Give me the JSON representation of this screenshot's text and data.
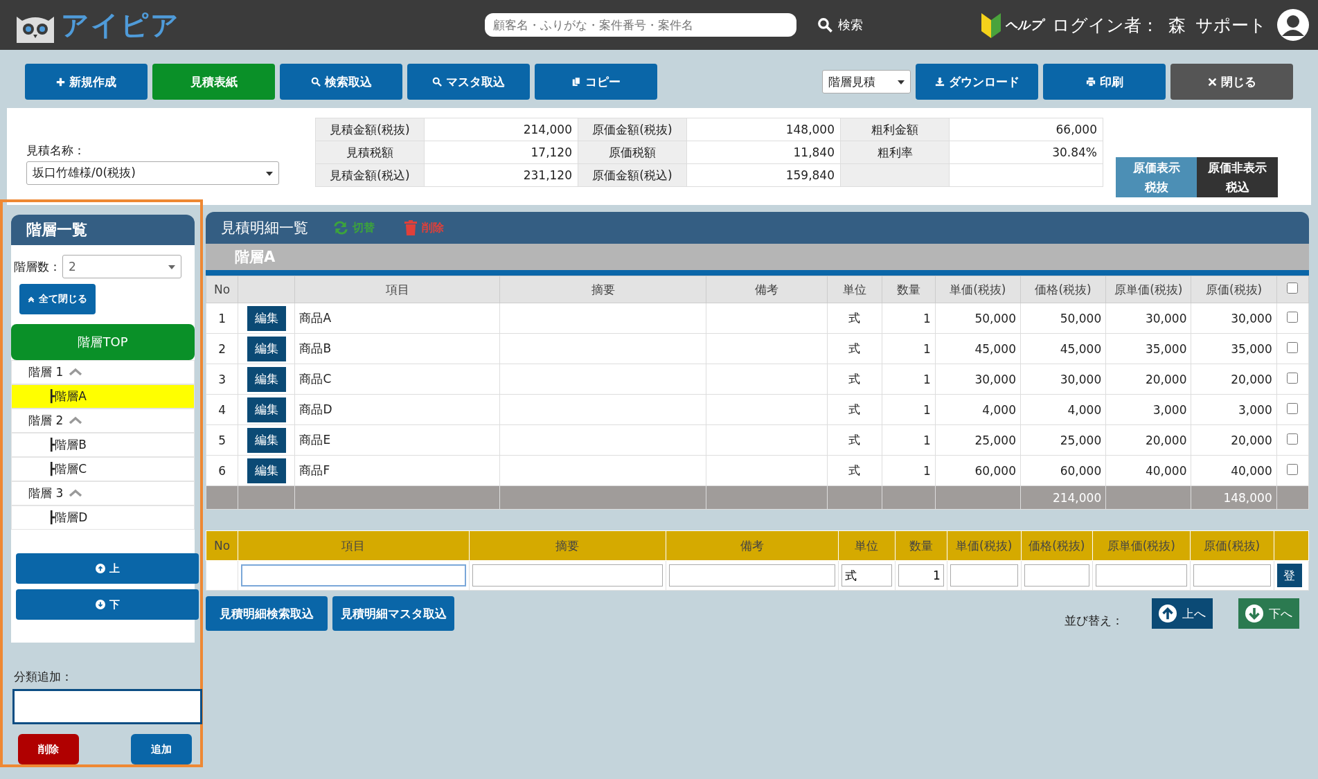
{
  "header": {
    "logo": "アイピア",
    "search": {
      "placeholder": "顧客名・ふりがな・案件番号・案件名"
    },
    "search_button": "検索",
    "help": "ヘルプ",
    "login_label": "ログイン者：",
    "user": "森",
    "support": "サポート"
  },
  "toolbar": {
    "left_buttons": [
      {
        "label": "新規作成",
        "kind": "primary"
      },
      {
        "label": "見積表紙",
        "kind": "success"
      },
      {
        "label": "検索取込",
        "kind": "primary"
      },
      {
        "label": "マスタ取込",
        "kind": "primary"
      },
      {
        "label": "コピー",
        "kind": "primary"
      }
    ],
    "mode_select": "階層見積",
    "right_buttons": [
      {
        "label": "ダウンロード",
        "kind": "primary"
      },
      {
        "label": "印刷",
        "kind": "primary"
      },
      {
        "label": "閉じる",
        "kind": "dark"
      }
    ]
  },
  "summary": {
    "name_label": "見積名称：",
    "name_value": "坂口竹雄様/0(税抜)",
    "rows": [
      [
        "見積金額(税抜)",
        "214,000",
        "原価金額(税抜)",
        "148,000",
        "粗利金額",
        "66,000"
      ],
      [
        "見積税額",
        "17,120",
        "原価税額",
        "11,840",
        "粗利率",
        "30.84%"
      ],
      [
        "見積金額(税込)",
        "231,120",
        "原価金額(税込)",
        "159,840",
        "",
        ""
      ]
    ],
    "toggles": [
      {
        "line1": "原価表示",
        "line2": "税抜",
        "selected": false
      },
      {
        "line1": "原価非表示",
        "line2": "税込",
        "selected": true
      }
    ]
  },
  "sidebar": {
    "title": "階層一覧",
    "count_label": "階層数：",
    "count_value": "2",
    "collapse_button": "全て閉じる",
    "top_button": "階層TOP",
    "tree": [
      {
        "label": "階層 1",
        "expanded": true,
        "children": [
          {
            "label": "┣階層A",
            "selected": true
          }
        ]
      },
      {
        "label": "階層 2",
        "expanded": true,
        "children": [
          {
            "label": "┣階層B",
            "selected": false
          },
          {
            "label": "┣階層C",
            "selected": false
          }
        ]
      },
      {
        "label": "階層 3",
        "expanded": true,
        "children": [
          {
            "label": "┣階層D",
            "selected": false
          }
        ]
      }
    ],
    "up_button": "上",
    "down_button": "下",
    "add_label": "分類追加：",
    "delete_button": "削除",
    "add_button": "追加"
  },
  "detail": {
    "title": "見積明細一覧",
    "switch_action": "切替",
    "delete_action": "削除",
    "group": "階層A",
    "columns": [
      "No",
      "",
      "項目",
      "摘要",
      "備考",
      "単位",
      "数量",
      "単価(税抜)",
      "価格(税抜)",
      "原単価(税抜)",
      "原価(税抜)"
    ],
    "rows": [
      {
        "no": "1",
        "edit": "編集",
        "item": "商品A",
        "unit": "式",
        "qty": "1",
        "unit_price": "50,000",
        "price": "50,000",
        "cost_unit": "30,000",
        "cost": "30,000",
        "checked": false
      },
      {
        "no": "2",
        "edit": "編集",
        "item": "商品B",
        "unit": "式",
        "qty": "1",
        "unit_price": "45,000",
        "price": "45,000",
        "cost_unit": "35,000",
        "cost": "35,000",
        "checked": false
      },
      {
        "no": "3",
        "edit": "編集",
        "item": "商品C",
        "unit": "式",
        "qty": "1",
        "unit_price": "30,000",
        "price": "30,000",
        "cost_unit": "20,000",
        "cost": "20,000",
        "checked": false
      },
      {
        "no": "4",
        "edit": "編集",
        "item": "商品D",
        "unit": "式",
        "qty": "1",
        "unit_price": "4,000",
        "price": "4,000",
        "cost_unit": "3,000",
        "cost": "3,000",
        "checked": false
      },
      {
        "no": "5",
        "edit": "編集",
        "item": "商品E",
        "unit": "式",
        "qty": "1",
        "unit_price": "25,000",
        "price": "25,000",
        "cost_unit": "20,000",
        "cost": "20,000",
        "checked": false
      },
      {
        "no": "6",
        "edit": "編集",
        "item": "商品F",
        "unit": "式",
        "qty": "1",
        "unit_price": "60,000",
        "price": "60,000",
        "cost_unit": "40,000",
        "cost": "40,000",
        "checked": false
      }
    ],
    "all_checked": false,
    "totals": {
      "price": "214,000",
      "cost": "148,000"
    },
    "entry": {
      "columns": [
        "No",
        "項目",
        "摘要",
        "備考",
        "単位",
        "数量",
        "単価(税抜)",
        "価格(税抜)",
        "原単価(税抜)",
        "原価(税抜)"
      ],
      "unit": "式",
      "qty": "1",
      "register": "登"
    },
    "buttons": [
      "見積明細検索取込",
      "見積明細マスタ取込"
    ],
    "sort_label": "並び替え：",
    "sort_up": "上へ",
    "sort_down": "下へ"
  }
}
